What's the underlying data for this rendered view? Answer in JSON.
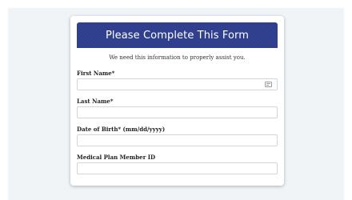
{
  "form": {
    "title": "Please Complete This Form",
    "intro": "We need this information to properly assist you.",
    "fields": [
      {
        "label": "First Name*",
        "value": "",
        "icon": "autofill-contact-icon"
      },
      {
        "label": "Last Name*",
        "value": ""
      },
      {
        "label": "Date of Birth* (mm/dd/yyyy)",
        "value": ""
      },
      {
        "label": "Medical Plan Member ID",
        "value": ""
      }
    ]
  },
  "colors": {
    "header_background": "#2e3d8c",
    "page_background": "#f0f4f6",
    "input_border": "#cfd6de"
  }
}
